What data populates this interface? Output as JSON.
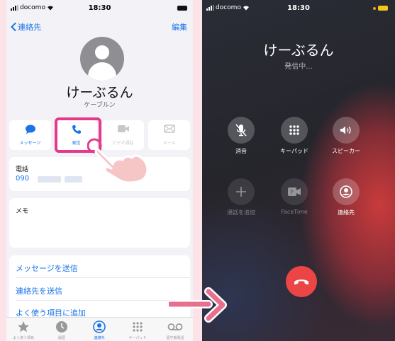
{
  "colors": {
    "accent": "#1a73e8",
    "highlight": "#e5398b",
    "end_call": "#eb4545",
    "page_bg": "#fbe3e8"
  },
  "left": {
    "status": {
      "carrier": "docomo",
      "time": "18:30"
    },
    "nav": {
      "back_label": "連絡先",
      "edit_label": "編集"
    },
    "contact": {
      "name": "けーぶるん",
      "reading": "ケーブルン"
    },
    "actions": [
      {
        "label": "メッセージ",
        "icon": "message-bubble-icon",
        "state": "enabled"
      },
      {
        "label": "発信",
        "icon": "phone-icon",
        "state": "enabled"
      },
      {
        "label": "ビデオ通話",
        "icon": "video-icon",
        "state": "disabled"
      },
      {
        "label": "メール",
        "icon": "mail-icon",
        "state": "disabled"
      }
    ],
    "phone_card": {
      "label": "電話",
      "number_prefix": "090"
    },
    "memo_card": {
      "label": "メモ"
    },
    "links": [
      "メッセージを送信",
      "連絡先を送信",
      "よく使う項目に追加"
    ],
    "tabs": [
      {
        "label": "よく使う項目",
        "icon": "star-icon"
      },
      {
        "label": "履歴",
        "icon": "clock-icon"
      },
      {
        "label": "連絡先",
        "icon": "person-circle-icon",
        "active": true
      },
      {
        "label": "キーパッド",
        "icon": "keypad-icon"
      },
      {
        "label": "留守番電話",
        "icon": "voicemail-icon"
      }
    ]
  },
  "right": {
    "status": {
      "carrier": "docomo",
      "time": "18:30"
    },
    "call": {
      "name": "けーぶるん",
      "status": "発信中..."
    },
    "buttons": [
      {
        "label": "消音",
        "icon": "mic-off-icon"
      },
      {
        "label": "キーパッド",
        "icon": "keypad-icon"
      },
      {
        "label": "スピーカー",
        "icon": "speaker-icon"
      },
      {
        "label": "通話を追加",
        "icon": "plus-icon",
        "dim": true
      },
      {
        "label": "FaceTime",
        "icon": "facetime-icon",
        "dim": true
      },
      {
        "label": "連絡先",
        "icon": "person-circle-icon"
      }
    ]
  }
}
